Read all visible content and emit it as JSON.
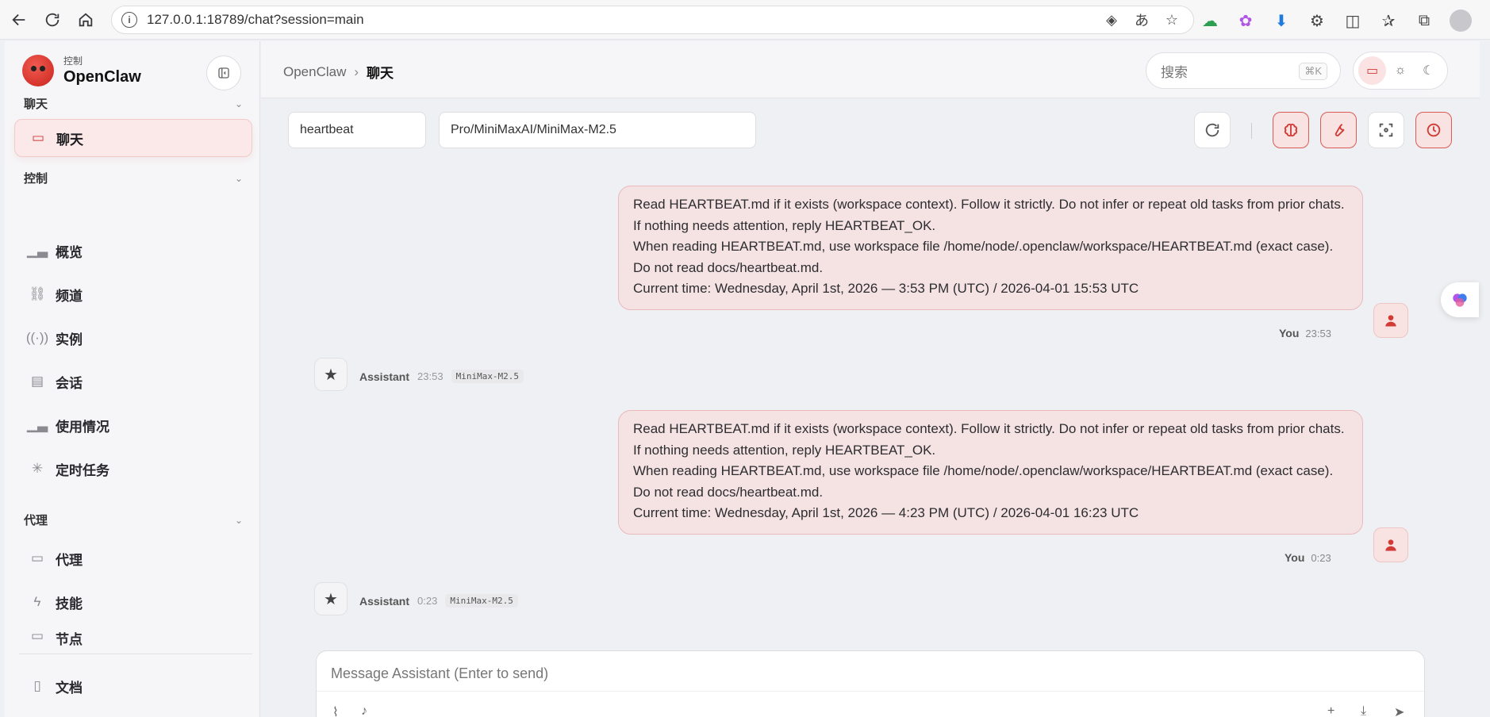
{
  "browser": {
    "url": "127.0.0.1:18789/chat?session=main",
    "icons": [
      "back-icon",
      "reload-icon",
      "home-icon",
      "info-icon",
      "copilot-icon",
      "translate-icon",
      "favorite-star-icon",
      "cloud-icon",
      "brain-extension-icon",
      "download-extension-icon",
      "puzzle-extension-icon",
      "split-screen-icon",
      "favorites-icon",
      "screenshot-icon",
      "profile-avatar"
    ]
  },
  "brand": {
    "subtitle": "控制",
    "name": "OpenClaw"
  },
  "sidebar": {
    "sections": [
      {
        "label": "聊天",
        "items": [
          {
            "label": "聊天",
            "icon": "chat-bubble-icon",
            "active": true
          }
        ]
      },
      {
        "label": "控制",
        "items": [
          {
            "label": "概览",
            "icon": "bar-chart-icon"
          },
          {
            "label": "频道",
            "icon": "link-icon"
          },
          {
            "label": "实例",
            "icon": "broadcast-icon"
          },
          {
            "label": "会话",
            "icon": "document-icon"
          },
          {
            "label": "使用情况",
            "icon": "bar-chart-icon"
          },
          {
            "label": "定时任务",
            "icon": "loader-icon"
          }
        ]
      },
      {
        "label": "代理",
        "items": [
          {
            "label": "代理",
            "icon": "folder-icon"
          },
          {
            "label": "技能",
            "icon": "lightning-icon"
          },
          {
            "label": "节点",
            "icon": "monitor-icon"
          }
        ]
      }
    ],
    "footer_item": {
      "label": "文档",
      "icon": "book-icon"
    }
  },
  "header": {
    "breadcrumb_root": "OpenClaw",
    "breadcrumb_sep": "›",
    "breadcrumb_current": "聊天",
    "search_placeholder": "搜索",
    "search_shortcut": "⌘K"
  },
  "toolbar": {
    "session": "heartbeat",
    "model": "Pro/MiniMaxAI/MiniMax-M2.5"
  },
  "messages": [
    {
      "role": "user",
      "lines": [
        "Read HEARTBEAT.md if it exists (workspace context). Follow it strictly. Do not infer or repeat old tasks from prior chats. If nothing needs attention, reply HEARTBEAT_OK.",
        "When reading HEARTBEAT.md, use workspace file /home/node/.openclaw/workspace/HEARTBEAT.md (exact case). Do not read docs/heartbeat.md.",
        "Current time: Wednesday, April 1st, 2026 — 3:53 PM (UTC) / 2026-04-01 15:53 UTC"
      ],
      "author": "You",
      "time": "23:53"
    },
    {
      "role": "assistant",
      "author": "Assistant",
      "time": "23:53",
      "model": "MiniMax-M2.5"
    },
    {
      "role": "user",
      "lines": [
        "Read HEARTBEAT.md if it exists (workspace context). Follow it strictly. Do not infer or repeat old tasks from prior chats. If nothing needs attention, reply HEARTBEAT_OK.",
        "When reading HEARTBEAT.md, use workspace file /home/node/.openclaw/workspace/HEARTBEAT.md (exact case). Do not read docs/heartbeat.md.",
        "Current time: Wednesday, April 1st, 2026 — 4:23 PM (UTC) / 2026-04-01 16:23 UTC"
      ],
      "author": "You",
      "time": "0:23"
    },
    {
      "role": "assistant",
      "author": "Assistant",
      "time": "0:23",
      "model": "MiniMax-M2.5"
    }
  ],
  "composer": {
    "placeholder": "Message Assistant (Enter to send)"
  },
  "colors": {
    "accent": "#d23b35",
    "accent_bg": "#f9e2e2",
    "user_bubble": "#f5e3e4"
  }
}
